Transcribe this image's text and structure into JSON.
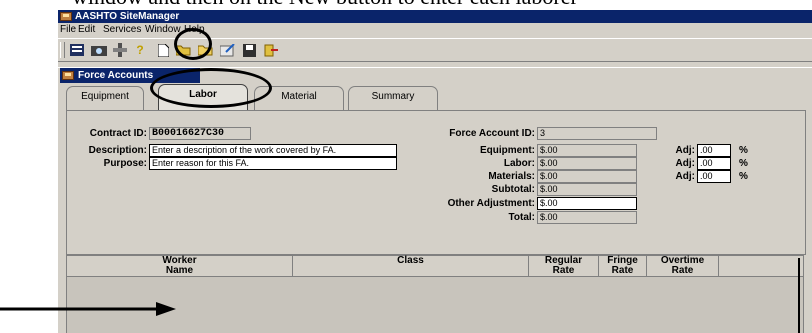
{
  "document": {
    "caption_fragment": "window and then on the New button to enter each laborer"
  },
  "app": {
    "title": "AASHTO SiteManager"
  },
  "menu": [
    "File",
    "Edit",
    "Services",
    "Window",
    "Help"
  ],
  "toolbar": {
    "icons": [
      "grid-icon",
      "camera-icon",
      "tools-icon",
      "help-icon",
      "new-icon",
      "open-folder-icon",
      "folder-icon",
      "edit-icon",
      "save-icon",
      "exit-icon"
    ]
  },
  "child_window": {
    "title": "Force Accounts"
  },
  "tabs": [
    "Equipment",
    "Labor",
    "Material",
    "Summary"
  ],
  "active_tab": "Labor",
  "form": {
    "contract_id_label": "Contract ID:",
    "contract_id_value": "B00016627C30",
    "force_account_id_label": "Force Account ID:",
    "force_account_id_value": "3",
    "description_label": "Description:",
    "description_value": "Enter a description of the work covered by FA.",
    "purpose_label": "Purpose:",
    "purpose_value": "Enter reason for this FA.",
    "equipment_label": "Equipment:",
    "equipment_value": "$.00",
    "labor_label": "Labor:",
    "labor_value": "$.00",
    "materials_label": "Materials:",
    "materials_value": "$.00",
    "subtotal_label": "Subtotal:",
    "subtotal_value": "$.00",
    "other_adjustment_label": "Other Adjustment:",
    "other_adjustment_value": "$.00",
    "total_label": "Total:",
    "total_value": "$.00",
    "adj_label": "Adj:",
    "adj_values": [
      ".00",
      ".00",
      ".00"
    ],
    "pct_symbol": "%"
  },
  "grid": {
    "columns": [
      "Worker\nName",
      "Class",
      "Regular\nRate",
      "Fringe\nRate",
      "Overtime\nRate"
    ]
  }
}
